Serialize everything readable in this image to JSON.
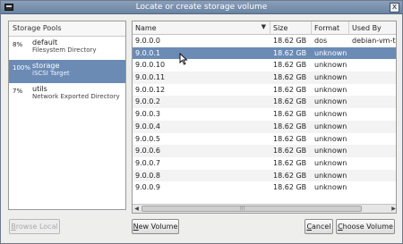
{
  "window": {
    "title": "Locate or create storage volume",
    "close_glyph": "x"
  },
  "pools": {
    "header": "Storage Pools",
    "items": [
      {
        "pct": "8%",
        "name": "default",
        "desc": "Filesystem Directory"
      },
      {
        "pct": "100%",
        "name": "storage",
        "desc": "iSCSI Target"
      },
      {
        "pct": "7%",
        "name": "utils",
        "desc": "Network Exported Directory"
      }
    ],
    "selected_index": 1
  },
  "volumes": {
    "columns": {
      "name": "Name",
      "size": "Size",
      "format": "Format",
      "used_by": "Used By"
    },
    "rows": [
      {
        "name": "9.0.0.0",
        "size": "18.62 GB",
        "format": "dos",
        "used_by": "debian-vm-te"
      },
      {
        "name": "9.0.0.1",
        "size": "18.62 GB",
        "format": "unknown",
        "used_by": ""
      },
      {
        "name": "9.0.0.10",
        "size": "18.62 GB",
        "format": "unknown",
        "used_by": ""
      },
      {
        "name": "9.0.0.11",
        "size": "18.62 GB",
        "format": "unknown",
        "used_by": ""
      },
      {
        "name": "9.0.0.12",
        "size": "18.62 GB",
        "format": "unknown",
        "used_by": ""
      },
      {
        "name": "9.0.0.2",
        "size": "18.62 GB",
        "format": "unknown",
        "used_by": ""
      },
      {
        "name": "9.0.0.3",
        "size": "18.62 GB",
        "format": "unknown",
        "used_by": ""
      },
      {
        "name": "9.0.0.4",
        "size": "18.62 GB",
        "format": "unknown",
        "used_by": ""
      },
      {
        "name": "9.0.0.5",
        "size": "18.62 GB",
        "format": "unknown",
        "used_by": ""
      },
      {
        "name": "9.0.0.6",
        "size": "18.62 GB",
        "format": "unknown",
        "used_by": ""
      },
      {
        "name": "9.0.0.7",
        "size": "18.62 GB",
        "format": "unknown",
        "used_by": ""
      },
      {
        "name": "9.0.0.8",
        "size": "18.62 GB",
        "format": "unknown",
        "used_by": ""
      },
      {
        "name": "9.0.0.9",
        "size": "18.62 GB",
        "format": "unknown",
        "used_by": ""
      }
    ],
    "selected_index": 1
  },
  "buttons": {
    "browse_local": {
      "pre": "",
      "key": "B",
      "post": "rowse Local"
    },
    "new_volume": {
      "pre": "",
      "key": "N",
      "post": "ew Volume"
    },
    "cancel": {
      "pre": "",
      "key": "C",
      "post": "ancel"
    },
    "choose_volume": {
      "pre": "",
      "key": "C",
      "post": "hoose Volume"
    }
  },
  "colors": {
    "selection": "#6b8bb5",
    "titlebar": "#7890af"
  },
  "icons": {
    "sort": "chevron-down-icon",
    "cursor": "mouse-pointer-icon"
  }
}
